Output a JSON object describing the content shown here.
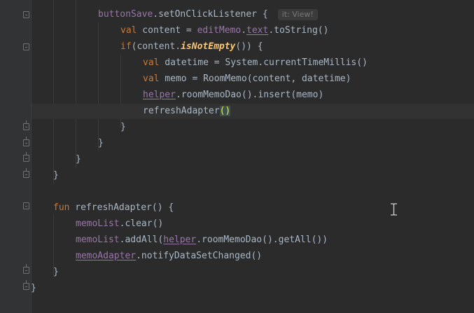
{
  "code": {
    "line1": {
      "obj": "buttonSave",
      "call": ".setOnClickListener {"
    },
    "hint": "it: View!",
    "line2": {
      "kw": "val",
      "rest1": " content = ",
      "obj": "editMemo",
      "dot": ".",
      "prop": "text",
      "rest2": ".toString()"
    },
    "line3": {
      "kw": "if",
      "rest1": "(content.",
      "ext": "isNotEmpty",
      "rest2": "()) {"
    },
    "line4": {
      "kw": "val",
      "rest": " datetime = System.currentTimeMillis()"
    },
    "line5": {
      "kw": "val",
      "rest": " memo = RoomMemo(content, datetime)"
    },
    "line6": {
      "obj": "helper",
      "rest": ".roomMemoDao().insert(memo)"
    },
    "line7": {
      "name": "refreshAdapter",
      "parens": "()"
    },
    "close_if": "}",
    "close_listener": "}",
    "close_method": "}",
    "close_class_inner": "}",
    "line12": {
      "kw": "fun",
      "rest": " refreshAdapter() {"
    },
    "line13": {
      "obj": "memoList",
      "rest": ".clear()"
    },
    "line14": {
      "obj": "memoList",
      "rest1": ".addAll(",
      "obj2": "helper",
      "rest2": ".roomMemoDao().getAll())"
    },
    "line15": {
      "obj": "memoAdapter",
      "rest": ".notifyDataSetChanged()"
    },
    "close_fun": "}",
    "close_class": "}"
  },
  "colors": {
    "background": "#2b2b2b",
    "keyword": "#cc7832",
    "field": "#9876aa",
    "text": "#a9b7c6"
  },
  "icons": {
    "cursor": "text-cursor-icon"
  }
}
